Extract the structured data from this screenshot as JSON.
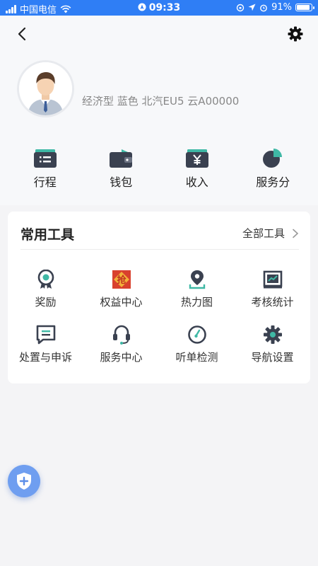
{
  "status_bar": {
    "carrier": "中国电信",
    "time": "09:33",
    "battery": "91%"
  },
  "header": {
    "vehicle_info": "经济型 蓝色 北汽EU5   云A00000"
  },
  "quick_actions": [
    {
      "label": "行程",
      "icon": "itinerary-icon"
    },
    {
      "label": "钱包",
      "icon": "wallet-icon"
    },
    {
      "label": "收入",
      "icon": "income-icon"
    },
    {
      "label": "服务分",
      "icon": "service-score-icon"
    }
  ],
  "tools": {
    "title": "常用工具",
    "all_label": "全部工具",
    "items": [
      {
        "label": "奖励",
        "icon": "reward-medal-icon"
      },
      {
        "label": "权益中心",
        "icon": "benefits-grab-icon"
      },
      {
        "label": "热力图",
        "icon": "heatmap-location-icon"
      },
      {
        "label": "考核统计",
        "icon": "statistics-chart-icon"
      },
      {
        "label": "处置与申诉",
        "icon": "appeal-message-icon"
      },
      {
        "label": "服务中心",
        "icon": "headset-icon"
      },
      {
        "label": "听单检测",
        "icon": "order-check-gauge-icon"
      },
      {
        "label": "导航设置",
        "icon": "navigation-settings-icon"
      }
    ]
  },
  "colors": {
    "status_bar": "#2f7ef5",
    "accent_teal": "#3fb8a5",
    "icon_dark": "#3a4150",
    "fab_blue": "#6f9ef0"
  }
}
